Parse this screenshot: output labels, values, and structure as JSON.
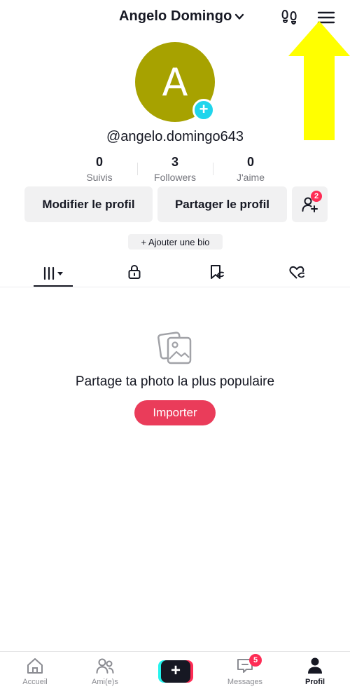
{
  "header": {
    "username": "Angelo Domingo",
    "icons": [
      "chevron-down-icon",
      "footprints-icon",
      "menu-icon"
    ]
  },
  "annotation": {
    "arrow_color": "#ffff00"
  },
  "profile": {
    "avatar_letter": "A",
    "avatar_color": "#a7a200",
    "handle": "@angelo.domingo643",
    "stats": [
      {
        "value": "0",
        "label": "Suivis"
      },
      {
        "value": "3",
        "label": "Followers"
      },
      {
        "value": "0",
        "label": "J'aime"
      }
    ],
    "edit_label": "Modifier le profil",
    "share_label": "Partager le profil",
    "friend_requests_badge": "2",
    "bio_label": "+ Ajouter une bio"
  },
  "tabs": [
    "videos-grid-icon",
    "lock-icon",
    "favorites-icon",
    "liked-icon"
  ],
  "empty_state": {
    "title": "Partage ta photo la plus populaire",
    "button_label": "Importer"
  },
  "bottom_nav": {
    "home_label": "Accueil",
    "friends_label": "Ami(e)s",
    "messages_label": "Messages",
    "messages_badge": "5",
    "profile_label": "Profil",
    "create_symbol": "+"
  },
  "colors": {
    "accent": "#fe2c55",
    "import_button": "#ea3c5a",
    "avatar_plus": "#20d5ec",
    "text": "#161823",
    "muted": "#73747b"
  }
}
